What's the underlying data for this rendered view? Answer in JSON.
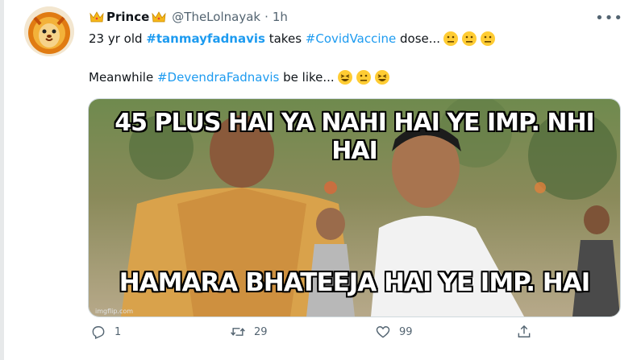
{
  "tweet": {
    "display_name": "Prince",
    "handle": "@TheLolnayak",
    "separator": "·",
    "time": "1h",
    "more_label": "•••",
    "line1": {
      "prefix": "23 yr old ",
      "hashtag1": "#tanmayfadnavis",
      "middle": " takes ",
      "hashtag2": "#CovidVaccine",
      "suffix": " dose..."
    },
    "line2": {
      "prefix": "Meanwhile ",
      "hashtag": "#DevendraFadnavis",
      "suffix": " be like..."
    }
  },
  "media": {
    "top_caption": "45 PLUS HAI YA NAHI HAI YE IMP. NHI HAI",
    "bottom_caption": "HAMARA BHATEEJA HAI YE IMP. HAI",
    "watermark": "imgflip.com"
  },
  "actions": {
    "reply_count": "1",
    "retweet_count": "29",
    "like_count": "99"
  },
  "colors": {
    "accent": "#1d9bf0",
    "secondary_text": "#536471"
  }
}
